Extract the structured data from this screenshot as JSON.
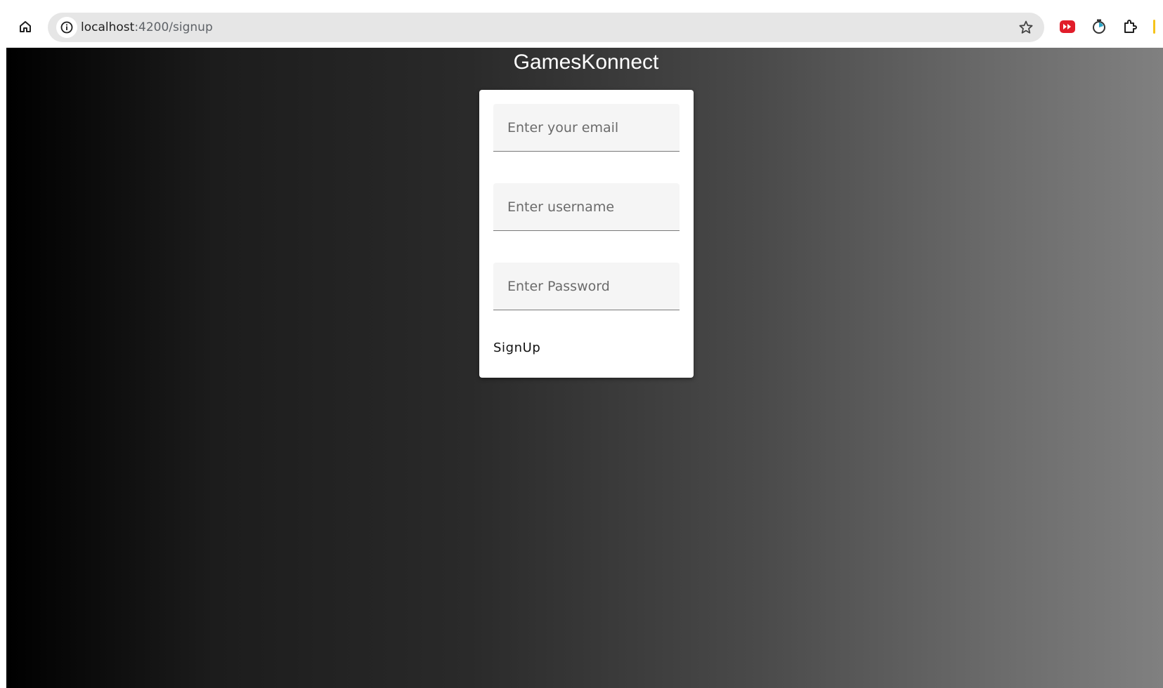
{
  "browser": {
    "url_host": "localhost",
    "url_path": ":4200/signup",
    "icons": {
      "home": "home-icon",
      "info": "info-icon",
      "bookmark": "star-icon",
      "extension_1": "youtube-icon",
      "extension_2": "timer-icon",
      "extensions": "puzzle-icon"
    },
    "colors": {
      "banner": "#fde068",
      "omnibox": "#e6e6e6"
    }
  },
  "app": {
    "title": "GamesKonnect"
  },
  "signup_form": {
    "email_placeholder": "Enter your email",
    "username_placeholder": "Enter username",
    "password_placeholder": "Enter Password",
    "submit_label": "SignUp"
  }
}
